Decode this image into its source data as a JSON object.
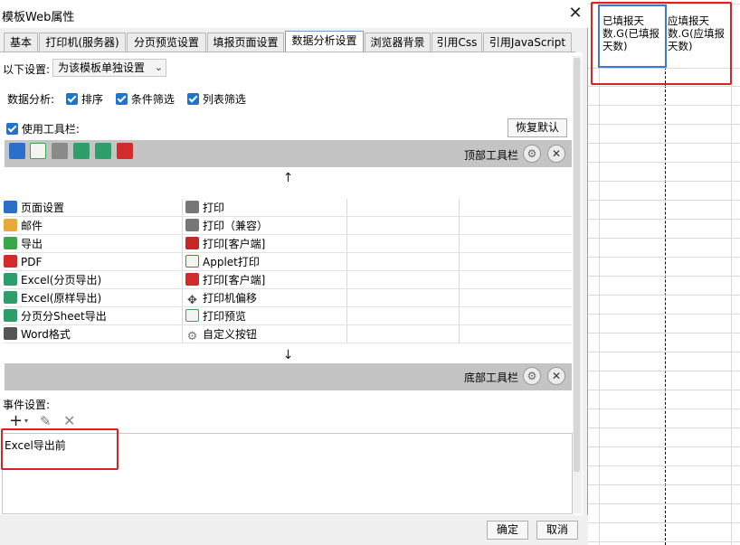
{
  "dialog": {
    "title": "模板Web属性",
    "close_glyph": "✕"
  },
  "tabs": [
    {
      "label": "基本"
    },
    {
      "label": "打印机(服务器)"
    },
    {
      "label": "分页预览设置"
    },
    {
      "label": "填报页面设置"
    },
    {
      "label": "数据分析设置",
      "active": true
    },
    {
      "label": "浏览器背景"
    },
    {
      "label": "引用Css"
    },
    {
      "label": "引用JavaScript"
    }
  ],
  "settings": {
    "scope_label": "以下设置:",
    "scope_value": "为该模板单独设置",
    "analysis_label": "数据分析:",
    "options": [
      "排序",
      "条件筛选",
      "列表筛选"
    ],
    "use_toolbar_label": "使用工具栏:",
    "restore_default": "恢复默认"
  },
  "top_toolbar": {
    "label": "顶部工具栏",
    "icons": [
      "page-setup-icon",
      "print-preview-icon",
      "print-icon",
      "excel-export-icon",
      "excel-original-icon",
      "pdf-icon"
    ]
  },
  "bottom_toolbar": {
    "label": "底部工具栏"
  },
  "arrows": {
    "up": "↑",
    "down": "↓"
  },
  "button_grid": {
    "col1": [
      {
        "label": "页面设置",
        "icon": "page-setup-icon",
        "color": "#2a6fc9"
      },
      {
        "label": "邮件",
        "icon": "mail-icon",
        "color": "#e8a93a"
      },
      {
        "label": "导出",
        "icon": "export-icon",
        "color": "#3aa64a"
      },
      {
        "label": "PDF",
        "icon": "pdf-icon",
        "color": "#d22b2b"
      },
      {
        "label": "Excel(分页导出)",
        "icon": "excel-page-export-icon",
        "color": "#2e9e6a"
      },
      {
        "label": "Excel(原样导出)",
        "icon": "excel-original-export-icon",
        "color": "#2e9e6a"
      },
      {
        "label": "分页分Sheet导出",
        "icon": "excel-sheet-export-icon",
        "color": "#2e9e6a"
      },
      {
        "label": "Word格式",
        "icon": "word-icon",
        "color": "#555555"
      }
    ],
    "col2": [
      {
        "label": "打印",
        "icon": "print-icon",
        "color": "#777777"
      },
      {
        "label": "打印（兼容）",
        "icon": "print-compatible-icon",
        "color": "#777777"
      },
      {
        "label": "打印[客户端]",
        "icon": "print-client-icon",
        "color": "#c62828"
      },
      {
        "label": "Applet打印",
        "icon": "applet-print-icon",
        "color": "#8a6d3b"
      },
      {
        "label": "打印[客户端]",
        "icon": "print-client-pdf-icon",
        "color": "#d22b2b"
      },
      {
        "label": "打印机偏移",
        "icon": "printer-offset-icon",
        "color": "#444444"
      },
      {
        "label": "打印预览",
        "icon": "print-preview-icon",
        "color": "#3aa64a"
      },
      {
        "label": "自定义按钮",
        "icon": "custom-button-icon",
        "color": "#777777"
      }
    ]
  },
  "events": {
    "label": "事件设置:",
    "items": [
      "Excel导出前"
    ]
  },
  "footer": {
    "ok": "确定",
    "cancel": "取消"
  },
  "sheet_cells": {
    "cell1": "已填报天数.G(已填报天数)",
    "cell2": "应填报天数.G(应填报天数)"
  },
  "colors": {
    "accent": "#1e75d0",
    "highlight_red": "#e02020",
    "selection_blue": "#3b78d8"
  }
}
